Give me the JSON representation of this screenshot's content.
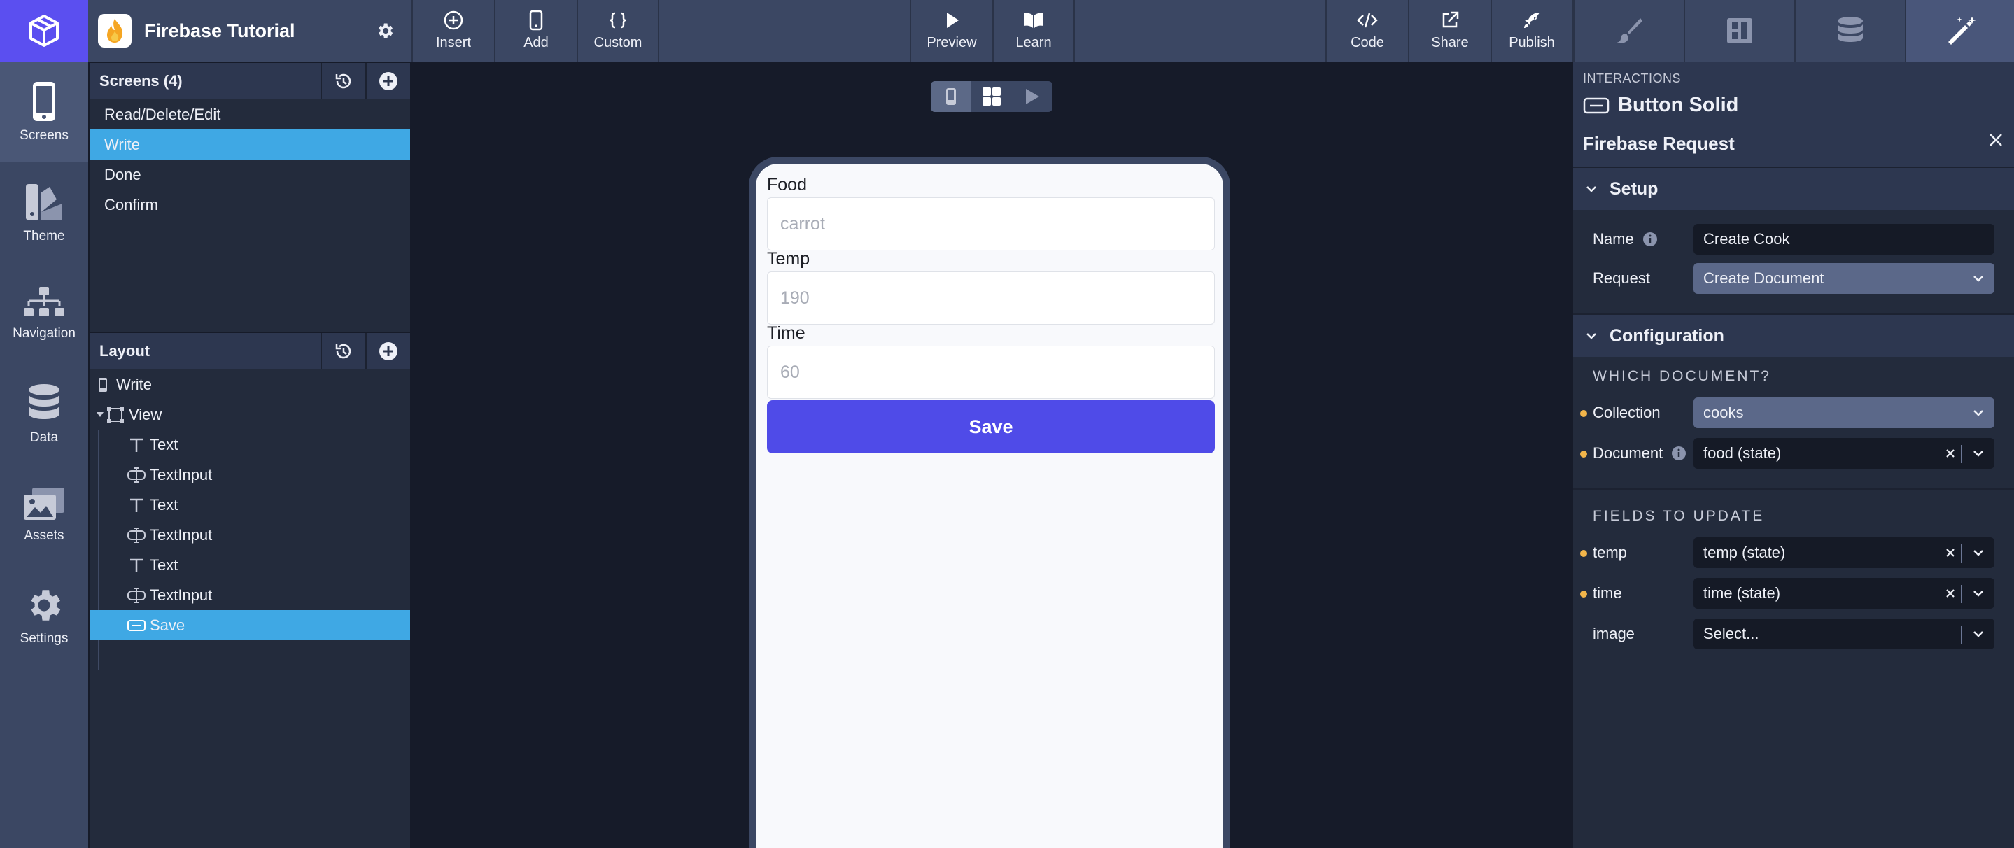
{
  "app": {
    "project_name": "Firebase Tutorial"
  },
  "toolbar": {
    "insert": "Insert",
    "add": "Add",
    "custom": "Custom",
    "preview": "Preview",
    "learn": "Learn",
    "code": "Code",
    "share": "Share",
    "publish": "Publish"
  },
  "rail": {
    "screens": "Screens",
    "theme": "Theme",
    "navigation": "Navigation",
    "data": "Data",
    "assets": "Assets",
    "settings": "Settings"
  },
  "screens_panel": {
    "title": "Screens (4)",
    "items": [
      "Read/Delete/Edit",
      "Write",
      "Done",
      "Confirm"
    ],
    "selected": "Write"
  },
  "layout_panel": {
    "title": "Layout",
    "tree": [
      {
        "label": "Write",
        "icon": "phone-icon",
        "depth": 0
      },
      {
        "label": "View",
        "icon": "view-frame-icon",
        "depth": 1
      },
      {
        "label": "Text",
        "icon": "text-icon",
        "depth": 2
      },
      {
        "label": "TextInput",
        "icon": "textinput-icon",
        "depth": 2
      },
      {
        "label": "Text",
        "icon": "text-icon",
        "depth": 2
      },
      {
        "label": "TextInput",
        "icon": "textinput-icon",
        "depth": 2
      },
      {
        "label": "Text",
        "icon": "text-icon",
        "depth": 2
      },
      {
        "label": "TextInput",
        "icon": "textinput-icon",
        "depth": 2
      },
      {
        "label": "Save",
        "icon": "button-icon",
        "depth": 2
      }
    ],
    "selected": "Save"
  },
  "phone": {
    "food_label": "Food",
    "food_placeholder": "carrot",
    "temp_label": "Temp",
    "temp_placeholder": "190",
    "time_label": "Time",
    "time_placeholder": "60",
    "save_button": "Save"
  },
  "right_panel": {
    "caption": "INTERACTIONS",
    "component": "Button Solid",
    "request_title": "Firebase Request",
    "setup": {
      "title": "Setup",
      "name_label": "Name",
      "name_value": "Create Cook",
      "request_label": "Request",
      "request_value": "Create Document"
    },
    "configuration": {
      "title": "Configuration",
      "which_document": "WHICH DOCUMENT?",
      "collection_label": "Collection",
      "collection_value": "cooks",
      "document_label": "Document",
      "document_value": "food (state)",
      "fields_to_update": "FIELDS TO UPDATE",
      "temp_label": "temp",
      "temp_value": "temp (state)",
      "time_label": "time",
      "time_value": "time (state)",
      "image_label": "image",
      "image_value": "Select..."
    }
  },
  "colors": {
    "accent": "#5b4ff0",
    "selection": "#3fa8e4",
    "save_button": "#4f4be8",
    "required_dot": "#f2b54a"
  }
}
